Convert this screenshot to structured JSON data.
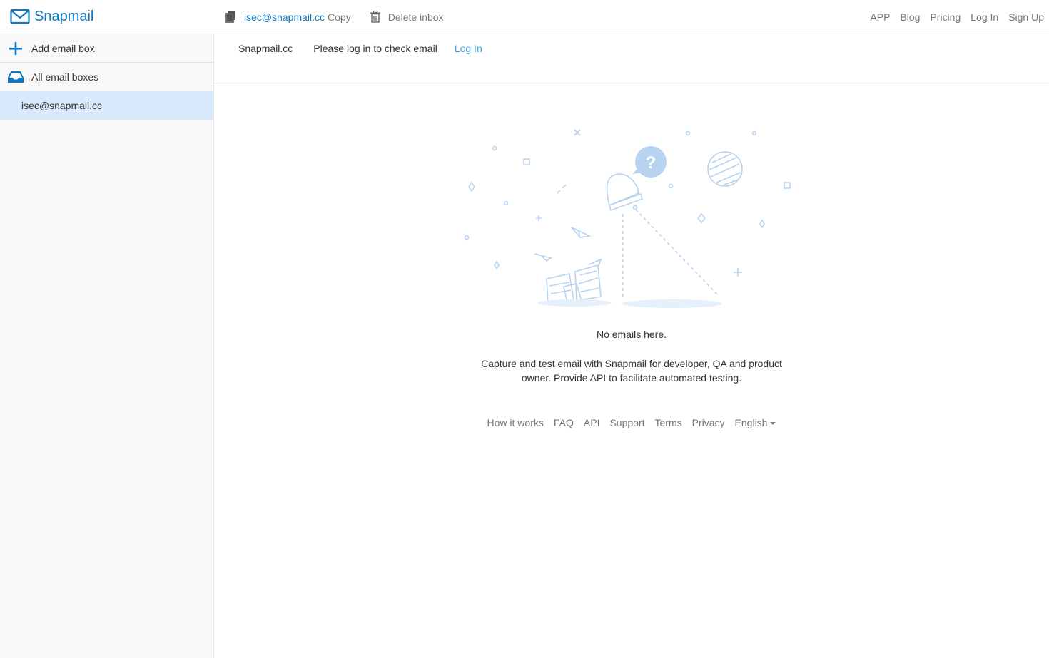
{
  "brand": {
    "name": "Snapmail",
    "icon": "envelope-icon",
    "color": "#1078c0"
  },
  "toolbar": {
    "email": "isec@snapmail.cc",
    "copy_label": "Copy",
    "delete_label": "Delete inbox"
  },
  "topnav": [
    "APP",
    "Blog",
    "Pricing",
    "Log In",
    "Sign Up"
  ],
  "sidebar": {
    "add_label": "Add email box",
    "all_label": "All email boxes",
    "mailboxes": [
      "isec@snapmail.cc"
    ]
  },
  "subbar": {
    "site": "Snapmail.cc",
    "message": "Please log in to check email",
    "login": "Log In"
  },
  "empty": {
    "title": "No emails here.",
    "description": "Capture and test email with Snapmail for developer, QA and product owner. Provide API to facilitate automated testing."
  },
  "footer": {
    "links": [
      "How it works",
      "FAQ",
      "API",
      "Support",
      "Terms",
      "Privacy"
    ],
    "language": "English"
  },
  "colors": {
    "accent": "#1078c0",
    "link": "#3fa4dc",
    "active_row": "#d8eafb",
    "sidebar_bg": "#f8f8f8"
  }
}
